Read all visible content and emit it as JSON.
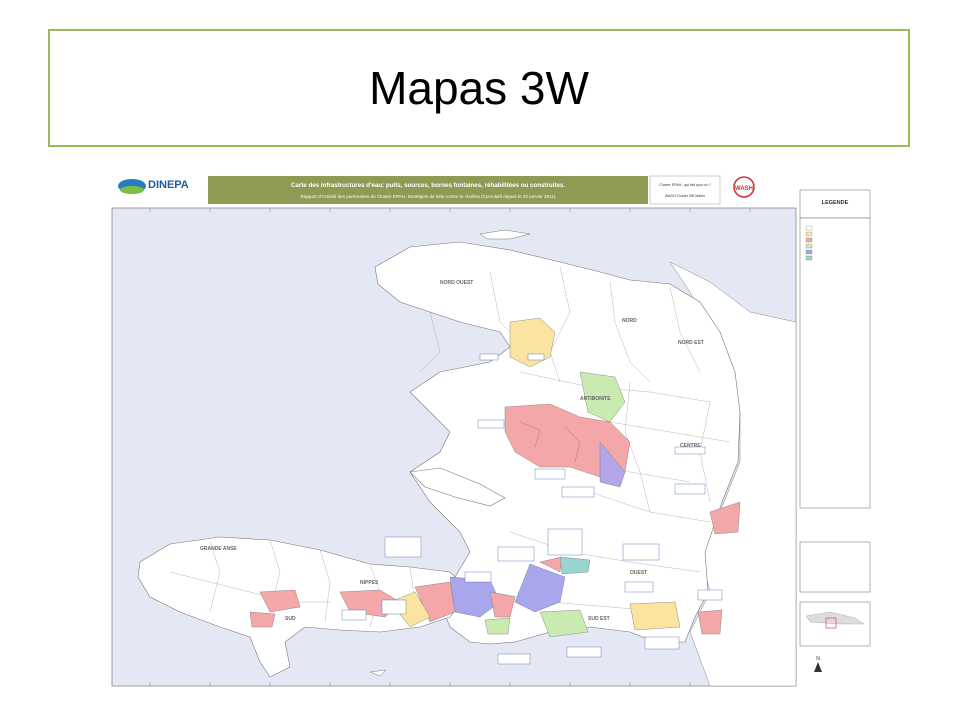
{
  "slide": {
    "title": "Mapas 3W"
  },
  "map": {
    "org_name": "DINEPA",
    "header_line1": "Carte des infrastructures d'eau: puits, sources, bornes fontaines, réhabilitées ou construites.",
    "header_line2": "Rapport d'Activité des partenaires du Cluster EPAH, Stratégies de lutte contre le choléra (Cumulatif depuis le 22 janvier 2011)",
    "cluster_box": "Cluster EPAH : qui fait quoi où ?",
    "cluster_box2": "WASH Cluster 3W Matrix",
    "wash_logo": "WASH",
    "legend_title": "LEGENDE",
    "departments": [
      {
        "name": "NORD OUEST"
      },
      {
        "name": "NORD"
      },
      {
        "name": "NORD EST"
      },
      {
        "name": "ARTIBONITE"
      },
      {
        "name": "CENTRE"
      },
      {
        "name": "OUEST"
      },
      {
        "name": "SUD EST"
      },
      {
        "name": "SUD"
      },
      {
        "name": "GRANDE ANSE"
      },
      {
        "name": "NIPPES"
      }
    ],
    "colors": {
      "sea": "#e4e8f4",
      "land": "#ffffff",
      "pink": "#f4a7a8",
      "yellow": "#fbe4a0",
      "green": "#c9eab0",
      "purple": "#a9a6ee",
      "teal": "#9ad4d0",
      "title_border": "#9bbb59",
      "header_bar": "#8f9a55"
    }
  }
}
